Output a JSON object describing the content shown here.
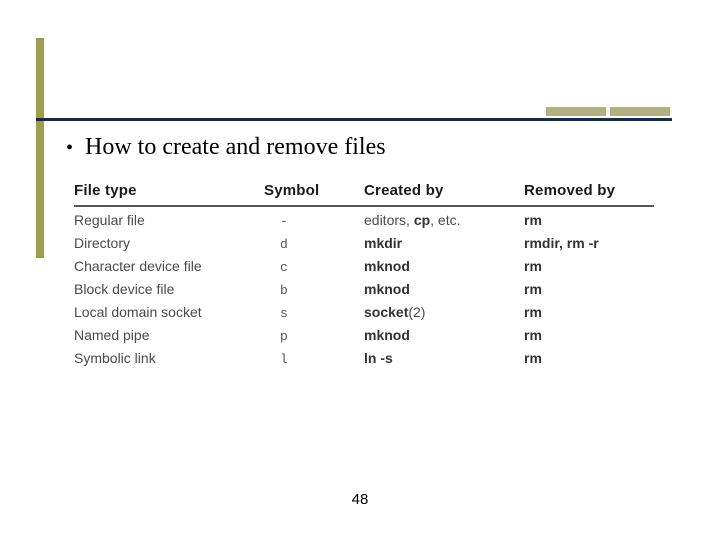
{
  "bullet": "How to create and remove files",
  "headers": {
    "type": "File type",
    "symbol": "Symbol",
    "created": "Created by",
    "removed": "Removed by"
  },
  "rows": [
    {
      "type": "Regular file",
      "symbol": "-",
      "created_prefix": "editors, ",
      "created_bold": "cp",
      "created_suffix": ", etc.",
      "removed": "rm"
    },
    {
      "type": "Directory",
      "symbol": "d",
      "created_prefix": "",
      "created_bold": "mkdir",
      "created_suffix": "",
      "removed": "rmdir, rm -r"
    },
    {
      "type": "Character device file",
      "symbol": "c",
      "created_prefix": "",
      "created_bold": "mknod",
      "created_suffix": "",
      "removed": "rm"
    },
    {
      "type": "Block device file",
      "symbol": "b",
      "created_prefix": "",
      "created_bold": "mknod",
      "created_suffix": "",
      "removed": "rm"
    },
    {
      "type": "Local domain socket",
      "symbol": "s",
      "created_prefix": "",
      "created_bold": "socket",
      "created_suffix": "(2)",
      "removed": "rm"
    },
    {
      "type": "Named pipe",
      "symbol": "p",
      "created_prefix": "",
      "created_bold": "mknod",
      "created_suffix": "",
      "removed": "rm"
    },
    {
      "type": "Symbolic link",
      "symbol": "l",
      "created_prefix": "",
      "created_bold": "ln -s",
      "created_suffix": "",
      "removed": "rm"
    }
  ],
  "page_number": "48"
}
